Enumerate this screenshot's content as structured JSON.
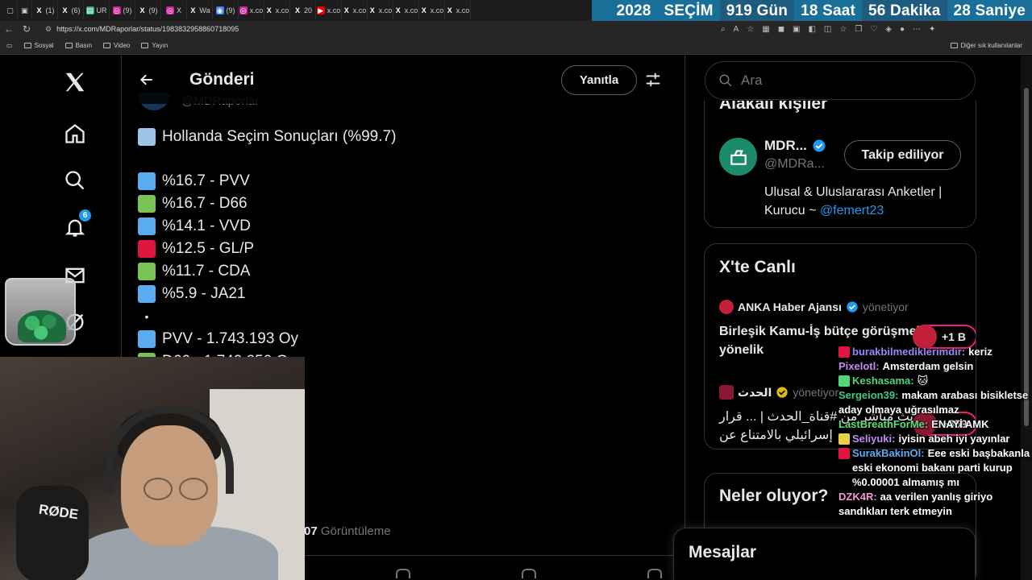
{
  "browser": {
    "tab_labels": [
      "(1)",
      "(6)",
      "UR",
      "(9)",
      "(9)",
      "X",
      "Wa",
      "(9)",
      "x.co",
      "x.co",
      "20",
      "x.co",
      "x.co",
      "x.co",
      "x.co",
      "x.co",
      "x.co"
    ],
    "url": "https://x.com/MDRaporlar/status/1983832958860718095",
    "bookmarks": [
      "Sosyal",
      "Basın",
      "Video",
      "Yayın"
    ],
    "bookmarks_other": "Diğer sık kullanılanlar"
  },
  "countdown": {
    "year": "2028",
    "label": "SEÇİM",
    "days": "919 Gün",
    "hours": "18 Saat",
    "minutes": "56 Dakika",
    "seconds": "28 Saniye"
  },
  "nav": {
    "notifications_badge": "6"
  },
  "main": {
    "title": "Gönderi",
    "reply_label": "Yanıtla",
    "author_handle": "@MDRaporlar",
    "post_title": "Hollanda Seçim Sonuçları (%99.7)",
    "results": [
      {
        "text": "%16.7 - PVV",
        "color": "#5aabf0"
      },
      {
        "text": "%16.7 - D66",
        "color": "#78c257"
      },
      {
        "text": "%14.1 - VVD",
        "color": "#5aabf0"
      },
      {
        "text": "%12.5 - GL/P",
        "color": "#e0153f"
      },
      {
        "text": "%11.7 - CDA",
        "color": "#78c257"
      },
      {
        "text": "%5.9 - JA21",
        "color": "#5aabf0"
      }
    ],
    "separator": "•",
    "votes": [
      {
        "text": "PVV - 1.743.193 Oy",
        "color": "#5aabf0"
      },
      {
        "text": "D66 - 1.740.250 Oy",
        "color": "#78c257"
      }
    ],
    "views_count": "07",
    "views_label": "Görüntüleme"
  },
  "right": {
    "search_placeholder": "Ara",
    "related_title": "Alakalı kişiler",
    "related_name": "MDR...",
    "related_handle": "@MDRa...",
    "follow_label": "Takip ediliyor",
    "related_bio": "Ulusal & Uluslararası Anketler | Kurucu ~",
    "related_bio_link": "@femert23",
    "live_title": "X'te Canlı",
    "live": [
      {
        "name": "ANKA Haber Ajansı",
        "role": "yönetiyor",
        "text": "Birleşik Kamu-İş bütçe görüşmelerine yönelik",
        "pill": "+1 B",
        "avatar_color": "#c21f3a"
      },
      {
        "name": "الحدث",
        "role": "yönetiyor",
        "text": "بث مباشر من #قناة_الحدث | ... قرار إسرائيلي بالامتناع عن",
        "pill": "+859",
        "avatar_color": "#8a1730"
      }
    ],
    "news_title": "Neler oluyor?",
    "messages_title": "Mesajlar"
  },
  "chat": [
    {
      "user": "burakbilmediklerimdir:",
      "text": "keriz",
      "color": "#9b87f5",
      "icon": "#e0153f"
    },
    {
      "user": "Pixelotl:",
      "text": "Amsterdam gelsin",
      "color": "#c38cf0",
      "icon": ""
    },
    {
      "user": "Keshasama:",
      "text": "🐱",
      "color": "#4fd67a",
      "icon": "#4fd67a"
    },
    {
      "user": "Sergeion39:",
      "text": "makam arabası bisikletse aday olmaya uğrasılmaz",
      "color": "#3ec78a",
      "icon": ""
    },
    {
      "user": "LastBreathForMe:",
      "text": "ENAYİ AMK",
      "color": "#5ee07a",
      "icon": ""
    },
    {
      "user": "Seliyuki:",
      "text": "iyisin abeh iyi yayınlar",
      "color": "#c38cf0",
      "icon": "#e8d24a"
    },
    {
      "user": "SurakBakinOl:",
      "text": "Eee eski başbakanla eski ekonomi bakanı parti kurup %0.00001 almamış mı",
      "color": "#5aabf0",
      "icon": "#e0153f"
    },
    {
      "user": "DZK4R:",
      "text": "aa verilen yanlış giriyo sandıkları terk etmeyin",
      "color": "#f09ad0",
      "icon": ""
    }
  ],
  "colors": {
    "accent": "#1d9bf0",
    "countdown_bg": "#1a6f99",
    "border": "#2f3336",
    "muted": "#71767b"
  }
}
